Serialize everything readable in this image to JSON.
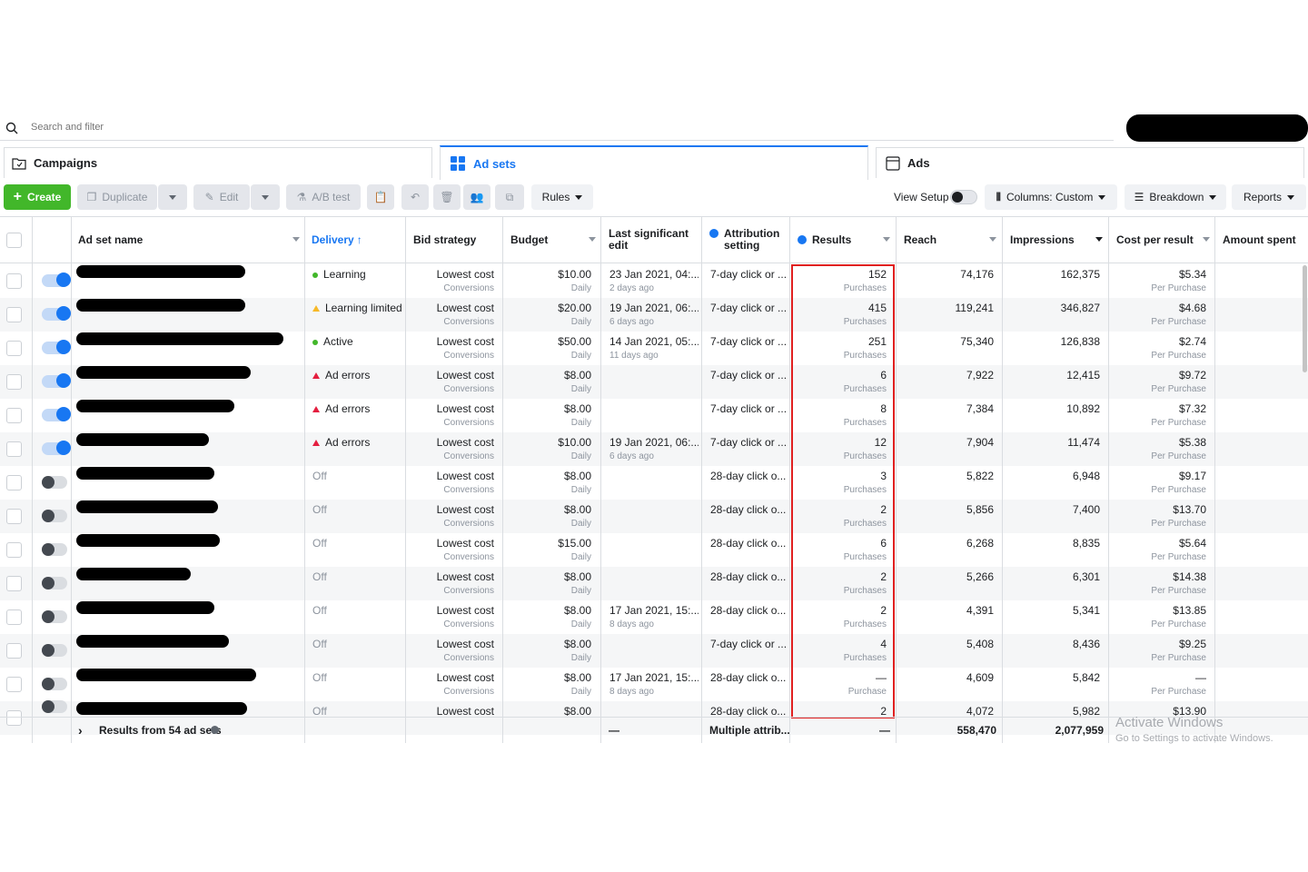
{
  "search": {
    "placeholder": "Search and filter"
  },
  "tabs": [
    {
      "label": "Campaigns",
      "icon": "folder-icon"
    },
    {
      "label": "Ad sets",
      "icon": "grid-icon"
    },
    {
      "label": "Ads",
      "icon": "ad-icon"
    }
  ],
  "toolbar": {
    "create": "Create",
    "duplicate": "Duplicate",
    "edit": "Edit",
    "ab_test": "A/B test",
    "rules": "Rules",
    "view_setup": "View Setup",
    "columns": "Columns: Custom",
    "breakdown": "Breakdown",
    "reports": "Reports"
  },
  "columns": {
    "name": "Ad set name",
    "delivery": "Delivery",
    "bid": "Bid strategy",
    "budget": "Budget",
    "last_edit": "Last significant edit",
    "attribution": "Attribution setting",
    "results": "Results",
    "reach": "Reach",
    "impressions": "Impressions",
    "cpr": "Cost per result",
    "spent": "Amount spent"
  },
  "rows": [
    {
      "on": true,
      "delivery": "Learning",
      "dstate": "green",
      "bid": "Lowest cost",
      "bid_sub": "Conversions",
      "budget": "$10.00",
      "budget_sub": "Daily",
      "edit": "23 Jan 2021, 04:...",
      "edit_sub": "2 days ago",
      "attr": "7-day click or ...",
      "results": "152",
      "results_sub": "Purchases",
      "reach": "74,176",
      "impr": "162,375",
      "cpr": "$5.34",
      "cpr_sub": "Per Purchase"
    },
    {
      "on": true,
      "delivery": "Learning limited",
      "dstate": "yellow",
      "bid": "Lowest cost",
      "bid_sub": "Conversions",
      "budget": "$20.00",
      "budget_sub": "Daily",
      "edit": "19 Jan 2021, 06:...",
      "edit_sub": "6 days ago",
      "attr": "7-day click or ...",
      "results": "415",
      "results_sub": "Purchases",
      "reach": "119,241",
      "impr": "346,827",
      "cpr": "$4.68",
      "cpr_sub": "Per Purchase"
    },
    {
      "on": true,
      "delivery": "Active",
      "dstate": "green",
      "bid": "Lowest cost",
      "bid_sub": "Conversions",
      "budget": "$50.00",
      "budget_sub": "Daily",
      "edit": "14 Jan 2021, 05:...",
      "edit_sub": "11 days ago",
      "attr": "7-day click or ...",
      "results": "251",
      "results_sub": "Purchases",
      "reach": "75,340",
      "impr": "126,838",
      "cpr": "$2.74",
      "cpr_sub": "Per Purchase"
    },
    {
      "on": true,
      "delivery": "Ad errors",
      "dstate": "red",
      "bid": "Lowest cost",
      "bid_sub": "Conversions",
      "budget": "$8.00",
      "budget_sub": "Daily",
      "edit": "",
      "edit_sub": "",
      "attr": "7-day click or ...",
      "results": "6",
      "results_sub": "Purchases",
      "reach": "7,922",
      "impr": "12,415",
      "cpr": "$9.72",
      "cpr_sub": "Per Purchase"
    },
    {
      "on": true,
      "delivery": "Ad errors",
      "dstate": "red",
      "bid": "Lowest cost",
      "bid_sub": "Conversions",
      "budget": "$8.00",
      "budget_sub": "Daily",
      "edit": "",
      "edit_sub": "",
      "attr": "7-day click or ...",
      "results": "8",
      "results_sub": "Purchases",
      "reach": "7,384",
      "impr": "10,892",
      "cpr": "$7.32",
      "cpr_sub": "Per Purchase"
    },
    {
      "on": true,
      "delivery": "Ad errors",
      "dstate": "red",
      "bid": "Lowest cost",
      "bid_sub": "Conversions",
      "budget": "$10.00",
      "budget_sub": "Daily",
      "edit": "19 Jan 2021, 06:...",
      "edit_sub": "6 days ago",
      "attr": "7-day click or ...",
      "results": "12",
      "results_sub": "Purchases",
      "reach": "7,904",
      "impr": "11,474",
      "cpr": "$5.38",
      "cpr_sub": "Per Purchase"
    },
    {
      "on": false,
      "delivery": "Off",
      "dstate": "off",
      "bid": "Lowest cost",
      "bid_sub": "Conversions",
      "budget": "$8.00",
      "budget_sub": "Daily",
      "edit": "",
      "edit_sub": "",
      "attr": "28-day click o...",
      "results": "3",
      "results_sub": "Purchases",
      "reach": "5,822",
      "impr": "6,948",
      "cpr": "$9.17",
      "cpr_sub": "Per Purchase"
    },
    {
      "on": false,
      "delivery": "Off",
      "dstate": "off",
      "bid": "Lowest cost",
      "bid_sub": "Conversions",
      "budget": "$8.00",
      "budget_sub": "Daily",
      "edit": "",
      "edit_sub": "",
      "attr": "28-day click o...",
      "results": "2",
      "results_sub": "Purchases",
      "reach": "5,856",
      "impr": "7,400",
      "cpr": "$13.70",
      "cpr_sub": "Per Purchase"
    },
    {
      "on": false,
      "delivery": "Off",
      "dstate": "off",
      "bid": "Lowest cost",
      "bid_sub": "Conversions",
      "budget": "$15.00",
      "budget_sub": "Daily",
      "edit": "",
      "edit_sub": "",
      "attr": "28-day click o...",
      "results": "6",
      "results_sub": "Purchases",
      "reach": "6,268",
      "impr": "8,835",
      "cpr": "$5.64",
      "cpr_sub": "Per Purchase"
    },
    {
      "on": false,
      "delivery": "Off",
      "dstate": "off",
      "bid": "Lowest cost",
      "bid_sub": "Conversions",
      "budget": "$8.00",
      "budget_sub": "Daily",
      "edit": "",
      "edit_sub": "",
      "attr": "28-day click o...",
      "results": "2",
      "results_sub": "Purchases",
      "reach": "5,266",
      "impr": "6,301",
      "cpr": "$14.38",
      "cpr_sub": "Per Purchase"
    },
    {
      "on": false,
      "delivery": "Off",
      "dstate": "off",
      "bid": "Lowest cost",
      "bid_sub": "Conversions",
      "budget": "$8.00",
      "budget_sub": "Daily",
      "edit": "17 Jan 2021, 15:...",
      "edit_sub": "8 days ago",
      "attr": "28-day click o...",
      "results": "2",
      "results_sub": "Purchases",
      "reach": "4,391",
      "impr": "5,341",
      "cpr": "$13.85",
      "cpr_sub": "Per Purchase"
    },
    {
      "on": false,
      "delivery": "Off",
      "dstate": "off",
      "bid": "Lowest cost",
      "bid_sub": "Conversions",
      "budget": "$8.00",
      "budget_sub": "Daily",
      "edit": "",
      "edit_sub": "",
      "attr": "7-day click or ...",
      "results": "4",
      "results_sub": "Purchases",
      "reach": "5,408",
      "impr": "8,436",
      "cpr": "$9.25",
      "cpr_sub": "Per Purchase"
    },
    {
      "on": false,
      "delivery": "Off",
      "dstate": "off",
      "bid": "Lowest cost",
      "bid_sub": "Conversions",
      "budget": "$8.00",
      "budget_sub": "Daily",
      "edit": "17 Jan 2021, 15:...",
      "edit_sub": "8 days ago",
      "attr": "28-day click o...",
      "results": "—",
      "results_sub": "Purchase",
      "reach": "4,609",
      "impr": "5,842",
      "cpr": "—",
      "cpr_sub": "Per Purchase"
    },
    {
      "on": false,
      "delivery": "Off",
      "dstate": "off",
      "bid": "Lowest cost",
      "bid_sub": "",
      "budget": "$8.00",
      "budget_sub": "",
      "edit": "",
      "edit_sub": "",
      "attr": "28-day click o...",
      "results": "2",
      "results_sub": "",
      "reach": "4,072",
      "impr": "5,982",
      "cpr": "$13.90",
      "cpr_sub": ""
    }
  ],
  "footer": {
    "label": "Results from 54 ad sets",
    "edit": "—",
    "attr": "Multiple attrib...",
    "results": "—",
    "reach": "558,470",
    "impr": "2,077,959"
  },
  "watermark": {
    "line1": "Activate Windows",
    "line2": "Go to Settings to activate Windows."
  },
  "colors": {
    "accent": "#1877f2",
    "create": "#42b72a",
    "highlight": "#e02020",
    "green": "#42b72a",
    "yellow": "#f7b928",
    "red": "#e41e3f"
  }
}
